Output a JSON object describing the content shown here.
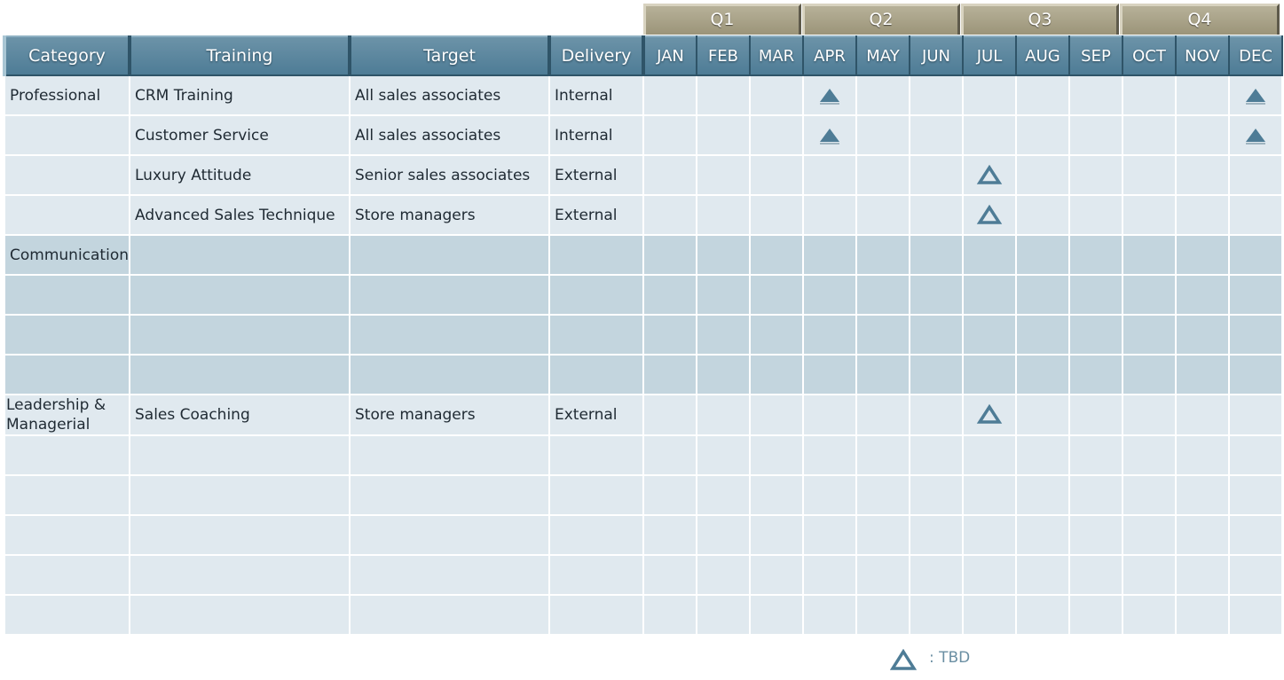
{
  "quarters": [
    "Q1",
    "Q2",
    "Q3",
    "Q4"
  ],
  "headers": {
    "category": "Category",
    "training": "Training",
    "target": "Target",
    "delivery": "Delivery",
    "months": [
      "JAN",
      "FEB",
      "MAR",
      "APR",
      "MAY",
      "JUN",
      "JUL",
      "AUG",
      "SEP",
      "OCT",
      "NOV",
      "DEC"
    ]
  },
  "rows": [
    {
      "category": "Professional",
      "training": "CRM Training",
      "target": "All sales associates",
      "delivery": "Internal",
      "marks": {
        "APR": "filled",
        "DEC": "filled"
      }
    },
    {
      "category": "",
      "training": "Customer Service",
      "target": "All sales associates",
      "delivery": "Internal",
      "marks": {
        "APR": "filled",
        "DEC": "filled"
      }
    },
    {
      "category": "",
      "training": "Luxury Attitude",
      "target": "Senior sales associates",
      "delivery": "External",
      "marks": {
        "JUL": "tbd"
      }
    },
    {
      "category": "",
      "training": "Advanced Sales Technique",
      "target": "Store managers",
      "delivery": "External",
      "marks": {
        "JUL": "tbd"
      }
    },
    {
      "category": "Communication",
      "training": "",
      "target": "",
      "delivery": "",
      "marks": {}
    },
    {
      "category": "",
      "training": "",
      "target": "",
      "delivery": "",
      "marks": {}
    },
    {
      "category": "",
      "training": "",
      "target": "",
      "delivery": "",
      "marks": {}
    },
    {
      "category": "",
      "training": "",
      "target": "",
      "delivery": "",
      "marks": {}
    },
    {
      "category": "Leadership & Managerial",
      "training": "Sales Coaching",
      "target": "Store managers",
      "delivery": "External",
      "marks": {
        "JUL": "tbd"
      }
    },
    {
      "category": "",
      "training": "",
      "target": "",
      "delivery": "",
      "marks": {}
    },
    {
      "category": "",
      "training": "",
      "target": "",
      "delivery": "",
      "marks": {}
    },
    {
      "category": "",
      "training": "",
      "target": "",
      "delivery": "",
      "marks": {}
    },
    {
      "category": "",
      "training": "",
      "target": "",
      "delivery": "",
      "marks": {}
    },
    {
      "category": "",
      "training": "",
      "target": "",
      "delivery": "",
      "marks": {}
    }
  ],
  "legend": {
    "icon": "tbd-triangle-outline-icon",
    "label": ": TBD"
  },
  "colors": {
    "mark": "#4e7c96",
    "header": "#5a86a0",
    "quarter": "#a8a288",
    "row_light": "#e0e9ef",
    "row_dark": "#c3d5de"
  }
}
